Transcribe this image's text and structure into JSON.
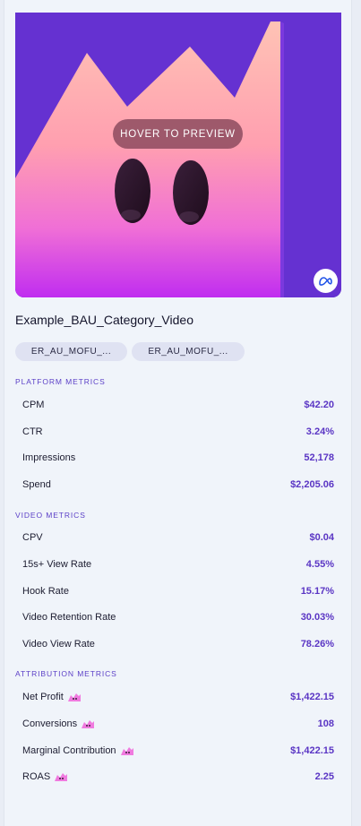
{
  "media": {
    "hover_label": "HOVER TO PREVIEW",
    "platform_icon": "meta-logo-icon",
    "colors": {
      "background": "#6531d1",
      "mountain_top": "#ffb3a8",
      "mountain_bottom": "#b52be8"
    }
  },
  "ad": {
    "title": "Example_BAU_Category_Video",
    "chips": [
      "ER_AU_MOFU_...",
      "ER_AU_MOFU_..."
    ]
  },
  "sections": {
    "platform": {
      "label": "PLATFORM METRICS",
      "metrics": [
        {
          "label": "CPM",
          "value": "$42.20"
        },
        {
          "label": "CTR",
          "value": "3.24%"
        },
        {
          "label": "Impressions",
          "value": "52,178"
        },
        {
          "label": "Spend",
          "value": "$2,205.06"
        }
      ]
    },
    "video": {
      "label": "VIDEO METRICS",
      "metrics": [
        {
          "label": "CPV",
          "value": "$0.04"
        },
        {
          "label": "15s+ View Rate",
          "value": "4.55%"
        },
        {
          "label": "Hook Rate",
          "value": "15.17%"
        },
        {
          "label": "Video Retention Rate",
          "value": "30.03%"
        },
        {
          "label": "Video View Rate",
          "value": "78.26%"
        }
      ]
    },
    "attribution": {
      "label": "ATTRIBUTION METRICS",
      "metrics": [
        {
          "label": "Net Profit",
          "value": "$1,422.15",
          "icon": "mini-mascot-icon"
        },
        {
          "label": "Conversions",
          "value": "108",
          "icon": "mini-mascot-icon"
        },
        {
          "label": "Marginal Contribution",
          "value": "$1,422.15",
          "icon": "mini-mascot-icon"
        },
        {
          "label": "ROAS",
          "value": "2.25",
          "icon": "mini-mascot-icon"
        }
      ]
    }
  },
  "accent_color": "#5a35c4"
}
